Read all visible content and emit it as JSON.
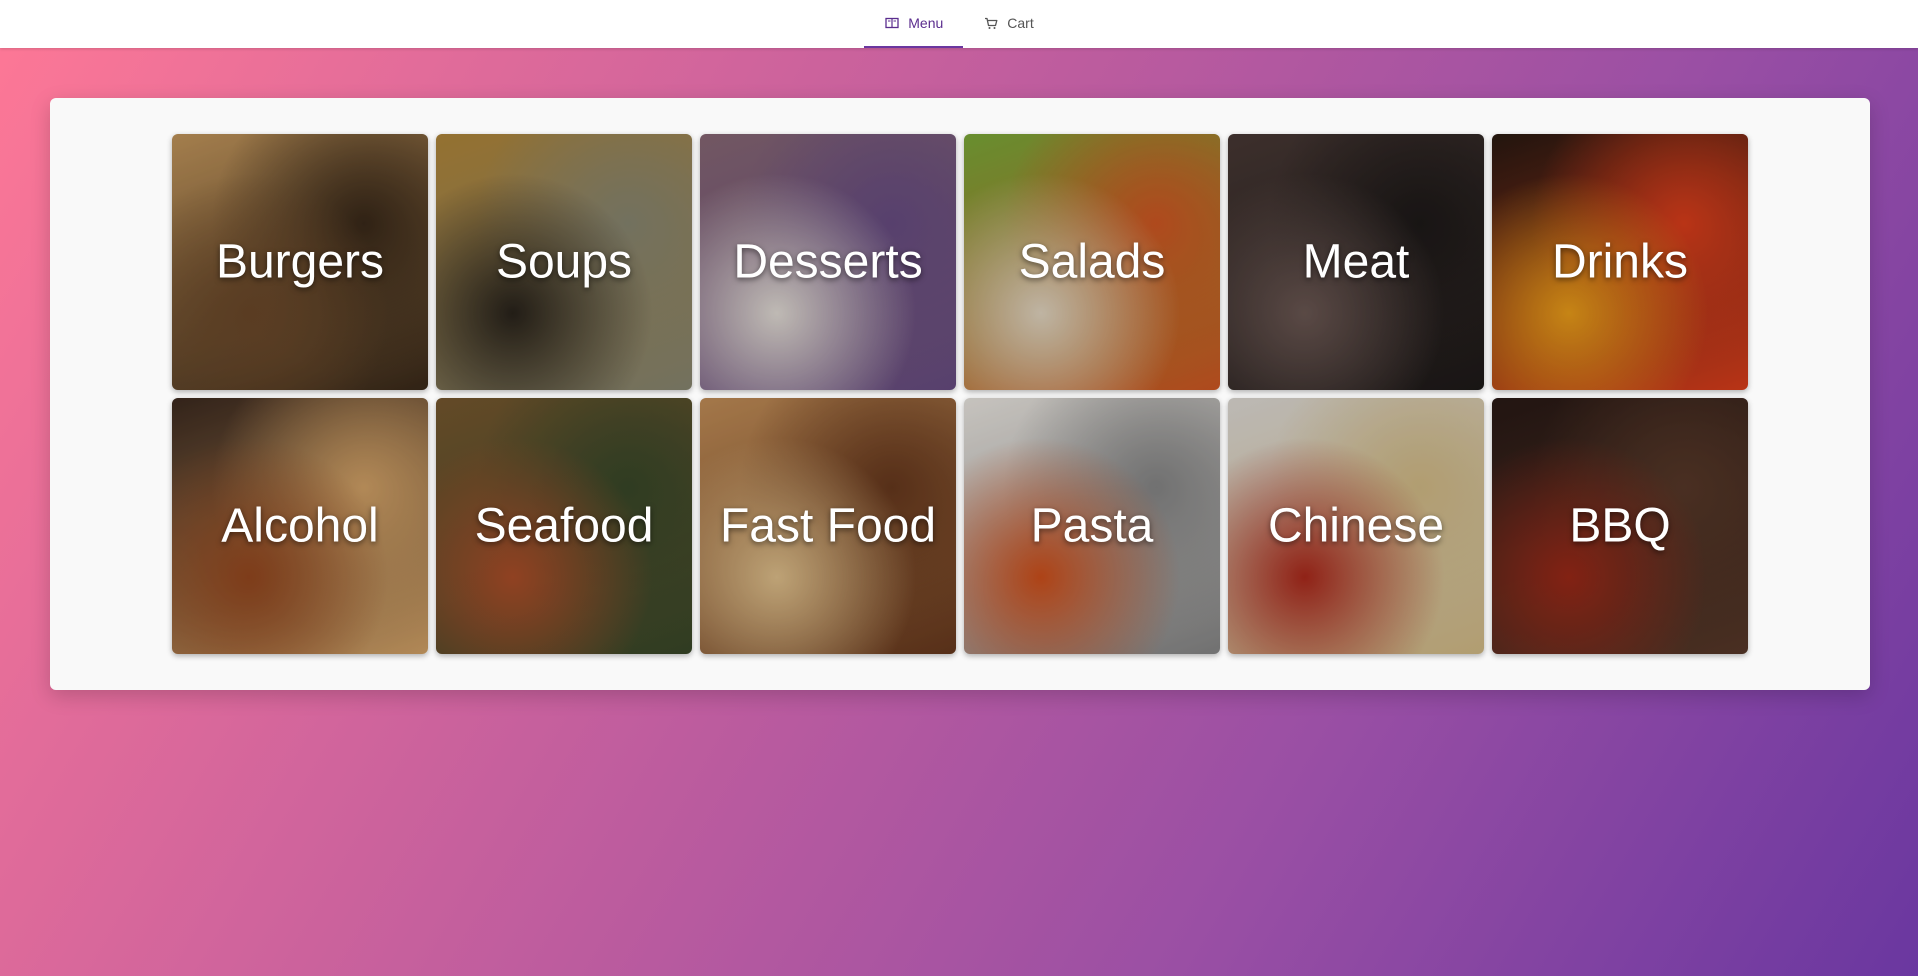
{
  "nav": {
    "tabs": [
      {
        "label": "Menu",
        "icon": "menu-book-icon",
        "active": true
      },
      {
        "label": "Cart",
        "icon": "cart-icon",
        "active": false
      }
    ]
  },
  "categories": [
    {
      "label": "Burgers",
      "colors": [
        "#c89a5e",
        "#6e4a2a",
        "#3b2a1a"
      ]
    },
    {
      "label": "Soups",
      "colors": [
        "#b58a3c",
        "#2a241c",
        "#8c8a74"
      ]
    },
    {
      "label": "Desserts",
      "colors": [
        "#8b6a78",
        "#e9e3dc",
        "#6b4f86"
      ]
    },
    {
      "label": "Salads",
      "colors": [
        "#7fae3a",
        "#e9dcc7",
        "#d65a24"
      ]
    },
    {
      "label": "Meat",
      "colors": [
        "#4a3a36",
        "#6e5a55",
        "#1e1a19"
      ]
    },
    {
      "label": "Drinks",
      "colors": [
        "#2a1a12",
        "#f2a21a",
        "#e2401c"
      ]
    },
    {
      "label": "Alcohol",
      "colors": [
        "#3e2b20",
        "#9a4a20",
        "#d9a76a"
      ]
    },
    {
      "label": "Seafood",
      "colors": [
        "#7a5a30",
        "#b0502a",
        "#3a4a2a"
      ]
    },
    {
      "label": "Fast Food",
      "colors": [
        "#c8925a",
        "#e7c690",
        "#6a3a1e"
      ]
    },
    {
      "label": "Pasta",
      "colors": [
        "#f2eee8",
        "#d4521c",
        "#8a8a8a"
      ]
    },
    {
      "label": "Chinese",
      "colors": [
        "#e6e2dc",
        "#b02a1c",
        "#d8c08a"
      ]
    },
    {
      "label": "BBQ",
      "colors": [
        "#2a1a16",
        "#a02a18",
        "#5a3a2a"
      ]
    }
  ]
}
